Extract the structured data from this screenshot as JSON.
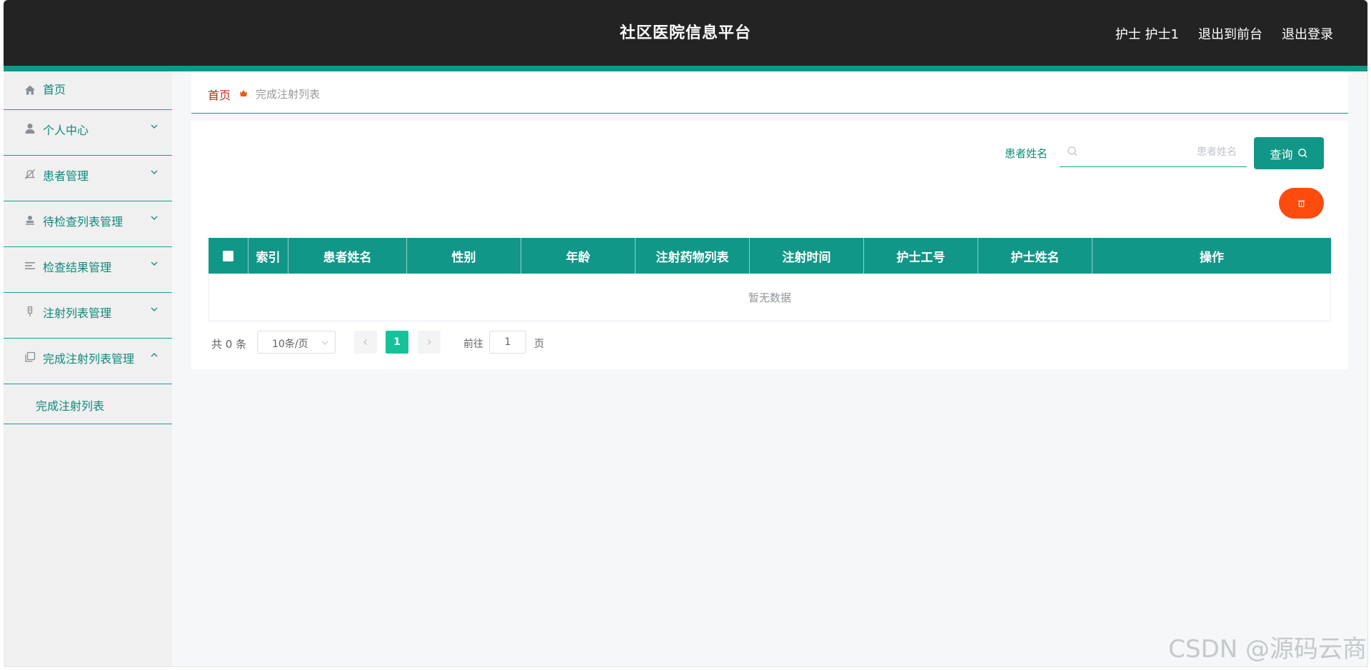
{
  "header": {
    "title": "社区医院信息平台",
    "user": "护士 护士1",
    "to_frontend": "退出到前台",
    "logout": "退出登录"
  },
  "sidebar": {
    "items": [
      {
        "label": "首页",
        "icon": "home-icon"
      },
      {
        "label": "个人中心",
        "icon": "user-icon"
      },
      {
        "label": "患者管理",
        "icon": "bell-off-icon"
      },
      {
        "label": "待检查列表管理",
        "icon": "user-stamp-icon"
      },
      {
        "label": "检查结果管理",
        "icon": "list-icon"
      },
      {
        "label": "注射列表管理",
        "icon": "syringe-icon"
      },
      {
        "label": "完成注射列表管理",
        "icon": "copy-icon"
      }
    ],
    "subitem": "完成注射列表"
  },
  "breadcrumb": {
    "home": "首页",
    "current": "完成注射列表"
  },
  "search": {
    "label": "患者姓名",
    "placeholder": "患者姓名",
    "button": "查询"
  },
  "table": {
    "columns": [
      "索引",
      "患者姓名",
      "性别",
      "年龄",
      "注射药物列表",
      "注射时间",
      "护士工号",
      "护士姓名",
      "操作"
    ],
    "empty_text": "暂无数据"
  },
  "pagination": {
    "total": "共 0 条",
    "page_size": "10条/页",
    "current_page": "1",
    "goto": "前往",
    "jump_value": "1",
    "unit": "页"
  },
  "watermark": "CSDN @源码云商",
  "colors": {
    "header_bg": "#232323",
    "accent": "#119787",
    "delete": "#ff4b0e",
    "active_page": "#16c29a",
    "breadcrumb_home": "#c7291c"
  }
}
